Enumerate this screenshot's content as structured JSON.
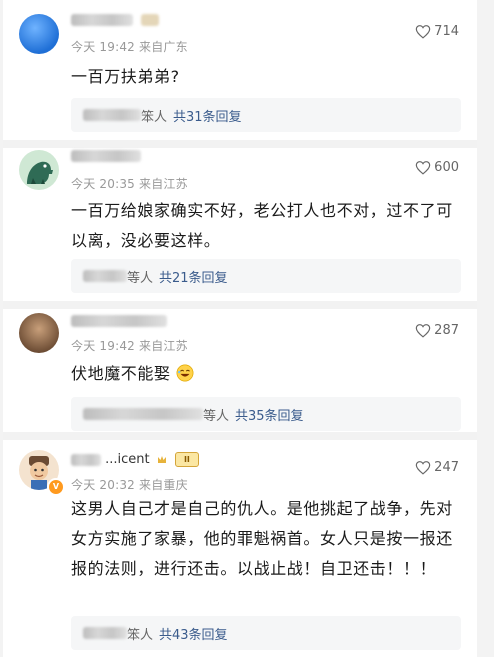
{
  "comments": [
    {
      "username_visible": "",
      "time": "今天 19:42 来自广东",
      "likes": "714",
      "text": "一百万扶弟弟?",
      "reply_names": "笨人",
      "reply_count": "共31条回复"
    },
    {
      "username_visible": "",
      "time": "今天 20:35 来自江苏",
      "likes": "600",
      "text": "一百万给娘家确实不好，老公打人也不对，过不了可以离，没必要这样。",
      "reply_names": "等人",
      "reply_count": "共21条回复"
    },
    {
      "username_visible": "",
      "time": "今天 19:42 来自江苏",
      "likes": "287",
      "text": "伏地魔不能娶",
      "reply_names": "等人",
      "reply_count": "共35条回复"
    },
    {
      "username_visible": "...icent",
      "badge": "II",
      "time": "今天 20:32 来自重庆",
      "likes": "247",
      "text": "这男人自己才是自己的仇人。是他挑起了战争，先对女方实施了家暴，他的罪魁祸首。女人只是按一报还报的法则，进行还击。以战止战！自卫还击！！！",
      "reply_names": "笨人",
      "reply_count": "共43条回复"
    }
  ],
  "icons": {
    "like": "heart-outline-icon",
    "laugh": "laughing-emoji-icon",
    "verified": "verified-badge-icon",
    "crown": "crown-icon"
  },
  "colors": {
    "reply_count": "#3a5b8c",
    "meta": "#999999",
    "divider": "#f2f2f2"
  }
}
